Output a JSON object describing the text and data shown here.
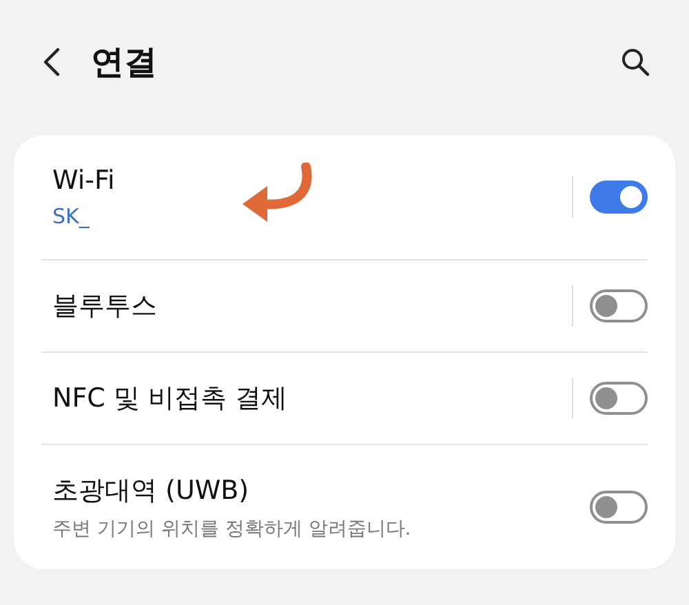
{
  "header": {
    "title": "연결"
  },
  "settings": [
    {
      "title": "Wi-Fi",
      "subtitle": "SK_",
      "on": true,
      "divider": true,
      "annotated": true
    },
    {
      "title": "블루투스",
      "on": false,
      "divider": true,
      "annotated": false
    },
    {
      "title": "NFC 및 비접촉 결제",
      "on": false,
      "divider": true,
      "annotated": false
    },
    {
      "title": "초광대역 (UWB)",
      "subtitle": "주변 기기의 위치를 정확하게 알려줍니다.",
      "on": false,
      "divider": false,
      "annotated": false
    }
  ]
}
